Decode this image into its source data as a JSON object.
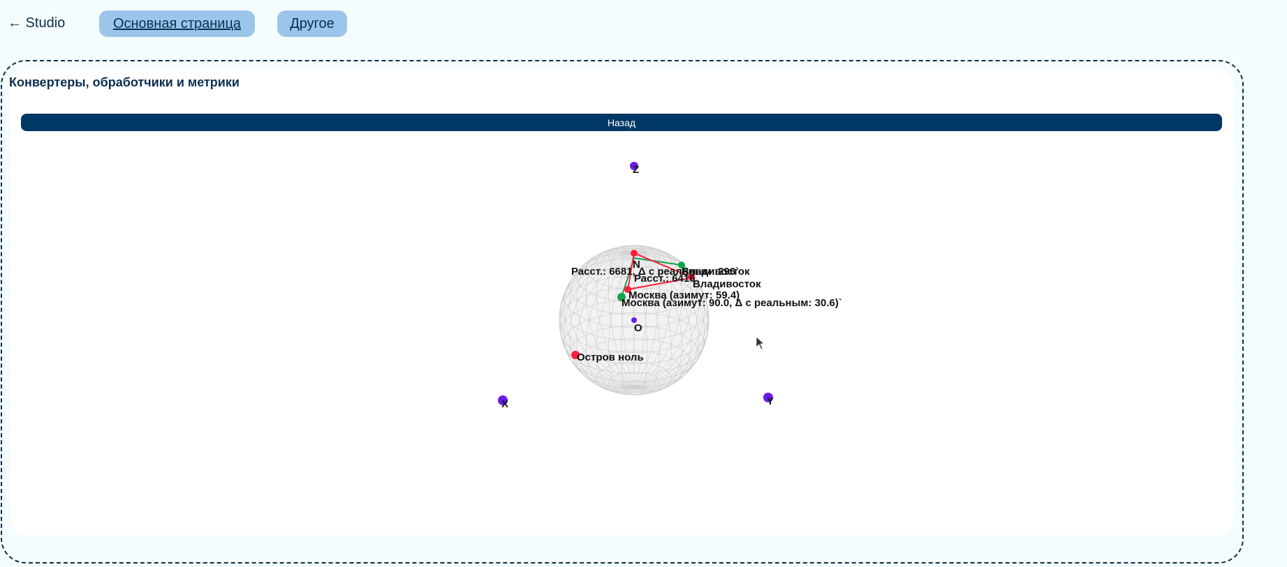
{
  "nav": {
    "back_label": "← Studio",
    "tabs": [
      {
        "label": "Основная страница",
        "active": true
      },
      {
        "label": "Другое",
        "active": false
      }
    ]
  },
  "panel": {
    "title": "Конвертеры, обработчики и метрики",
    "back_button": "Назад"
  },
  "plot": {
    "axes": {
      "z": "Z",
      "x": "X",
      "y": "Y",
      "origin": "O",
      "north": "N"
    },
    "labels": {
      "dist_green": "Расст.: 6681, Δ с реальным: 296`",
      "city_green_top": "Владивосток",
      "dist_red": "Расст.: 6416",
      "city_red": "Владивосток",
      "moscow_red": "Москва (азимут: 59.4)",
      "moscow_green": "Москва (азимут: 90.0, Δ с реальным: 30.6)`",
      "null_island": "Остров ноль"
    },
    "colors": {
      "axis_point": "#6a1bea",
      "red": "#ff1d3a",
      "green": "#12a54a",
      "sphere": "#c9c9c9"
    }
  }
}
